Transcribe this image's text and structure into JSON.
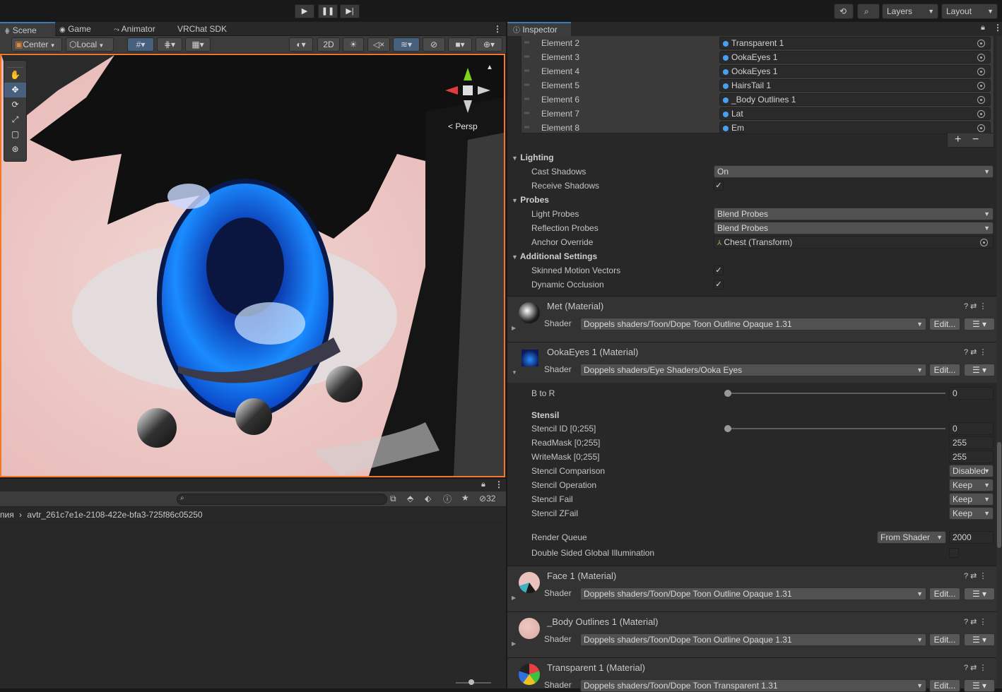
{
  "toolbar": {
    "layers_label": "Layers",
    "layout_label": "Layout"
  },
  "scene": {
    "tabs": [
      {
        "label": "Scene"
      },
      {
        "label": "Game"
      },
      {
        "label": "Animator"
      },
      {
        "label": "VRChat SDK"
      }
    ],
    "pivot_label": "Center",
    "space_label": "Local",
    "mode_2d_label": "2D",
    "persp_label": "Persp"
  },
  "project": {
    "breadcrumb_prefix": "пия",
    "breadcrumb_item": "avtr_261c7e1e-2108-422e-bfa3-725f86c05250",
    "hidden_count": "32",
    "search_placeholder": ""
  },
  "inspector": {
    "title": "Inspector",
    "elements": [
      {
        "label": "Element 2",
        "value": "Transparent 1"
      },
      {
        "label": "Element 3",
        "value": "OokaEyes 1"
      },
      {
        "label": "Element 4",
        "value": "OokaEyes 1"
      },
      {
        "label": "Element 5",
        "value": "HairsTail 1"
      },
      {
        "label": "Element 6",
        "value": "_Body Outlines 1"
      },
      {
        "label": "Element 7",
        "value": "Lat"
      },
      {
        "label": "Element 8",
        "value": "Em"
      }
    ],
    "add_label": "+",
    "remove_label": "−",
    "lighting": {
      "header": "Lighting",
      "cast_shadows_label": "Cast Shadows",
      "cast_shadows_value": "On",
      "receive_shadows_label": "Receive Shadows",
      "receive_shadows_checked": true
    },
    "probes": {
      "header": "Probes",
      "light_probes_label": "Light Probes",
      "light_probes_value": "Blend Probes",
      "reflection_probes_label": "Reflection Probes",
      "reflection_probes_value": "Blend Probes",
      "anchor_override_label": "Anchor Override",
      "anchor_override_value": "Chest (Transform)"
    },
    "additional": {
      "header": "Additional Settings",
      "skinned_motion_label": "Skinned Motion Vectors",
      "skinned_motion_checked": true,
      "dynamic_occlusion_label": "Dynamic Occlusion",
      "dynamic_occlusion_checked": true
    },
    "shader_label": "Shader",
    "edit_label": "Edit...",
    "materials": [
      {
        "name": "Met (Material)",
        "shader": "Doppels shaders/Toon/Dope Toon Outline Opaque 1.31"
      },
      {
        "name": "OokaEyes 1 (Material)",
        "shader": "Doppels shaders/Eye Shaders/Ooka Eyes"
      },
      {
        "name": "Face 1 (Material)",
        "shader": "Doppels shaders/Toon/Dope Toon Outline Opaque 1.31"
      },
      {
        "name": "_Body Outlines 1 (Material)",
        "shader": "Doppels shaders/Toon/Dope Toon Outline Opaque 1.31"
      },
      {
        "name": "Transparent 1 (Material)",
        "shader": "Doppels shaders/Toon/Dope Toon Transparent 1.31"
      }
    ],
    "ooka": {
      "b_to_r_label": "B to R",
      "b_to_r_value": "0",
      "b_to_r_fraction": 0,
      "stencil_header": "Stensil",
      "stencil_id_label": "Stencil ID [0;255]",
      "stencil_id_value": "0",
      "stencil_id_fraction": 0,
      "readmask_label": "ReadMask [0;255]",
      "readmask_value": "255",
      "writemask_label": "WriteMask [0;255]",
      "writemask_value": "255",
      "comparison_label": "Stencil Comparison",
      "comparison_value": "Disabled",
      "operation_label": "Stencil Operation",
      "operation_value": "Keep",
      "fail_label": "Stencil Fail",
      "fail_value": "Keep",
      "zfail_label": "Stencil ZFail",
      "zfail_value": "Keep",
      "render_queue_label": "Render Queue",
      "render_queue_mode": "From Shader",
      "render_queue_value": "2000",
      "dsgi_label": "Double Sided Global Illumination",
      "dsgi_checked": false
    }
  }
}
